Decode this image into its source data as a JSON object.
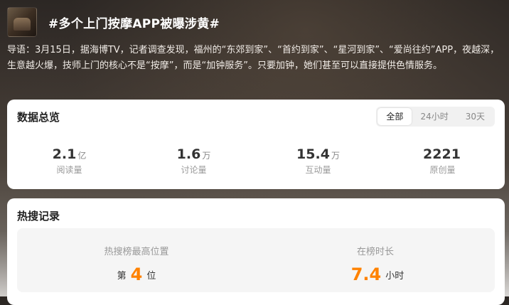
{
  "header": {
    "title": "#多个上门按摩APP被曝涉黄#"
  },
  "intro": "导语：3月15日，据海博TV，记者调查发现，福州的“东郊到家”、“首约到家”、“星河到家”、“爱尚往约”APP，夜越深，生意越火爆，技师上门的核心不是“按摩”，而是“加钟服务”。只要加钟，她们甚至可以直接提供色情服务。",
  "overview": {
    "title": "数据总览",
    "tabs": [
      "全部",
      "24小时",
      "30天"
    ],
    "active_tab": "全部",
    "stats": [
      {
        "value": "2.1",
        "unit": "亿",
        "label": "阅读量"
      },
      {
        "value": "1.6",
        "unit": "万",
        "label": "讨论量"
      },
      {
        "value": "15.4",
        "unit": "万",
        "label": "互动量"
      },
      {
        "value": "2221",
        "unit": "",
        "label": "原创量"
      }
    ]
  },
  "hot": {
    "title": "热搜记录",
    "peak_label": "热搜榜最高位置",
    "peak_prefix": "第",
    "peak_value": "4",
    "peak_suffix": "位",
    "duration_label": "在榜时长",
    "duration_value": "7.4",
    "duration_suffix": "小时"
  },
  "colors": {
    "accent": "#ff8200"
  }
}
